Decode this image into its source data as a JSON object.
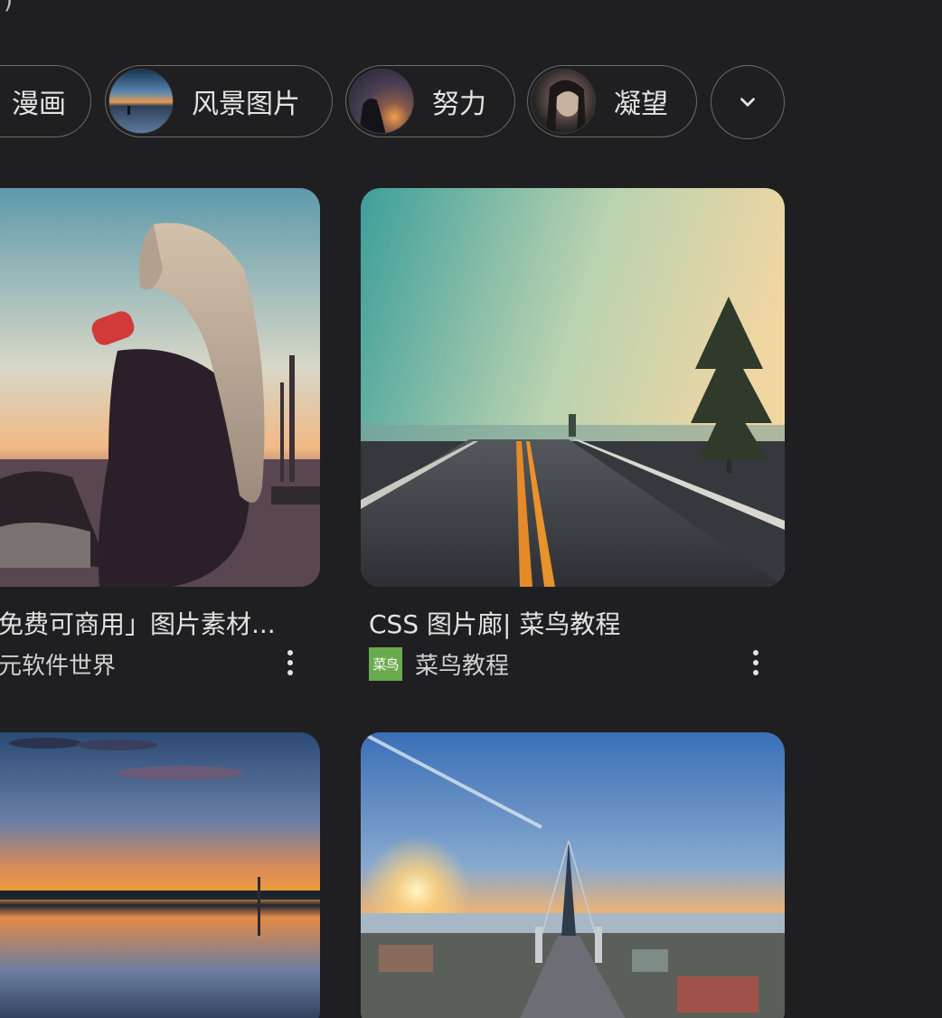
{
  "top_fragment": ")",
  "chips": [
    {
      "label": "漫画"
    },
    {
      "label": "风景图片",
      "thumb": "sunset-lake-thumbnail"
    },
    {
      "label": "努力",
      "thumb": "silhouette-sunset-thumbnail"
    },
    {
      "label": "凝望",
      "thumb": "portrait-girl-thumbnail"
    }
  ],
  "chips_more_icon": "chevron-down-icon",
  "results": [
    {
      "title": "免费可商用」图片素材...",
      "source": "元软件世界",
      "image": "girl-drinking-at-sunset",
      "menu_icon": "more-vert-icon"
    },
    {
      "title": "CSS 图片廊| 菜鸟教程",
      "source": "菜鸟教程",
      "favicon_text": "菜鸟",
      "favicon_color": "#6aab4e",
      "image": "foggy-road-with-tree",
      "menu_icon": "more-vert-icon"
    },
    {
      "image": "sunset-over-water"
    },
    {
      "image": "cable-stayed-bridge-city-sunset"
    }
  ],
  "colors": {
    "background": "#1f1f21",
    "text": "#e3e3e3",
    "chip_border": "#6b6b6b"
  }
}
